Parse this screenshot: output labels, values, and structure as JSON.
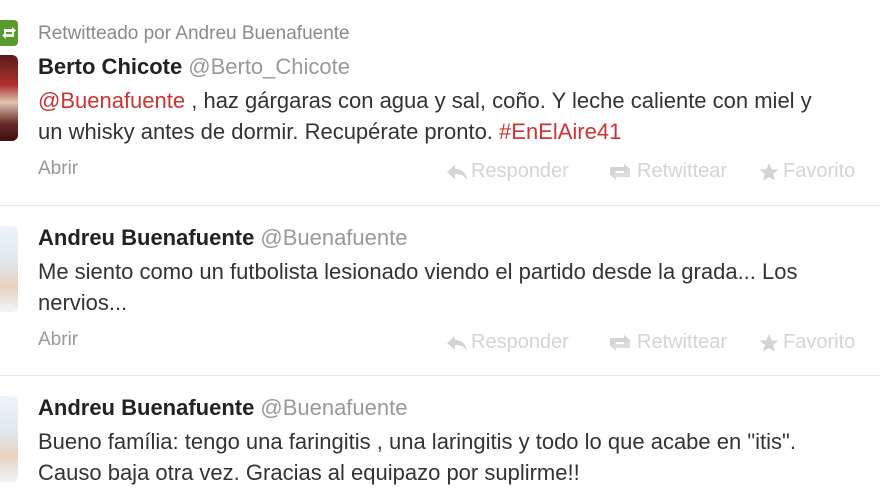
{
  "retweet_context": {
    "text": "Retwitteado por Andreu Buenafuente"
  },
  "tweets": [
    {
      "name": "Berto Chicote",
      "handle": "@Berto_Chicote",
      "mention": "@Buenafuente",
      "line1_rest": " , haz gárgaras con agua y sal, coño. Y leche caliente con miel y",
      "line2": "un whisky antes de dormir. Recupérate pronto. ",
      "hashtag": "#EnElAire41",
      "open_label": "Abrir"
    },
    {
      "name": "Andreu Buenafuente",
      "handle": "@Buenafuente",
      "line1": "Me siento como un futbolista lesionado viendo el partido desde la grada... Los",
      "line2": "nervios...",
      "open_label": "Abrir"
    },
    {
      "name": "Andreu Buenafuente",
      "handle": "@Buenafuente",
      "line1": "Bueno família: tengo una faringitis , una laringitis y todo lo que acabe en \"itis\".",
      "line2": "Causo baja otra vez. Gracias al equipazo por suplirme!!"
    }
  ],
  "actions": {
    "reply": "Responder",
    "retweet": "Retwittear",
    "favorite": "Favorito"
  },
  "colors": {
    "link": "#cc3333",
    "retweet_icon": "#5a9a2c",
    "muted": "#999999",
    "action": "#d4d4d4"
  }
}
